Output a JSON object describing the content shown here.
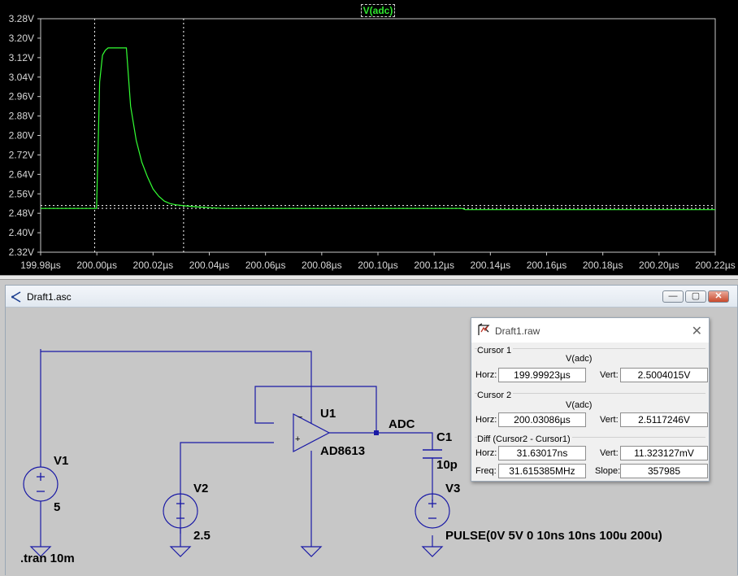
{
  "waveform": {
    "trace_label": "V(adc)",
    "trace_color": "#33ff33",
    "background": "#000000",
    "y_ticks": [
      "3.28V",
      "3.20V",
      "3.12V",
      "3.04V",
      "2.96V",
      "2.88V",
      "2.80V",
      "2.72V",
      "2.64V",
      "2.56V",
      "2.48V",
      "2.40V",
      "2.32V"
    ],
    "x_ticks": [
      "199.98µs",
      "200.00µs",
      "200.02µs",
      "200.04µs",
      "200.06µs",
      "200.08µs",
      "200.10µs",
      "200.12µs",
      "200.14µs",
      "200.16µs",
      "200.18µs",
      "200.20µs",
      "200.22µs"
    ]
  },
  "chart_data": {
    "type": "line",
    "title": "V(adc)",
    "x_unit": "µs",
    "y_unit": "V",
    "xlim": [
      199.98,
      200.22
    ],
    "ylim": [
      2.32,
      3.28
    ],
    "series": [
      {
        "name": "V(adc)",
        "x": [
          199.98,
          199.99,
          199.9999,
          200.0005,
          200.001,
          200.002,
          200.003,
          200.004,
          200.005,
          200.007,
          200.009,
          200.0105,
          200.012,
          200.014,
          200.016,
          200.018,
          200.02,
          200.022,
          200.024,
          200.026,
          200.028,
          200.031,
          200.035,
          200.04,
          200.045,
          200.13,
          200.131,
          200.22
        ],
        "y": [
          2.5,
          2.5,
          2.5,
          2.78,
          3.02,
          3.13,
          3.15,
          3.16,
          3.16,
          3.16,
          3.16,
          3.16,
          2.92,
          2.78,
          2.69,
          2.63,
          2.58,
          2.55,
          2.53,
          2.52,
          2.515,
          2.511,
          2.507,
          2.503,
          2.5,
          2.5,
          2.495,
          2.495
        ]
      }
    ],
    "cursors": [
      {
        "name": "Cursor 1",
        "x": 199.99923,
        "y": 2.5004015
      },
      {
        "name": "Cursor 2",
        "x": 200.03086,
        "y": 2.5117246
      }
    ]
  },
  "window": {
    "title": "Draft1.asc",
    "minimize": "—",
    "maximize": "▢",
    "close": "✕"
  },
  "schematic": {
    "v1_name": "V1",
    "v1_value": "5",
    "v2_name": "V2",
    "v2_value": "2.5",
    "v3_name": "V3",
    "v3_value": "PULSE(0V 5V 0 10ns 10ns 100u 200u)",
    "u1_name": "U1",
    "u1_part": "AD8613",
    "net_label": "ADC",
    "c1_name": "C1",
    "c1_value": "10p",
    "directive": ".tran 10m",
    "plus": "+",
    "minus": "−"
  },
  "cursor_panel": {
    "title": "Draft1.raw",
    "cursor1": {
      "heading": "Cursor 1",
      "signal": "V(adc)",
      "horz_label": "Horz:",
      "horz": "199.99923µs",
      "vert_label": "Vert:",
      "vert": "2.5004015V"
    },
    "cursor2": {
      "heading": "Cursor 2",
      "signal": "V(adc)",
      "horz_label": "Horz:",
      "horz": "200.03086µs",
      "vert_label": "Vert:",
      "vert": "2.5117246V"
    },
    "diff": {
      "heading": "Diff (Cursor2 - Cursor1)",
      "horz_label": "Horz:",
      "horz": "31.63017ns",
      "vert_label": "Vert:",
      "vert": "11.323127mV",
      "freq_label": "Freq:",
      "freq": "31.615385MHz",
      "slope_label": "Slope:",
      "slope": "357985"
    }
  }
}
